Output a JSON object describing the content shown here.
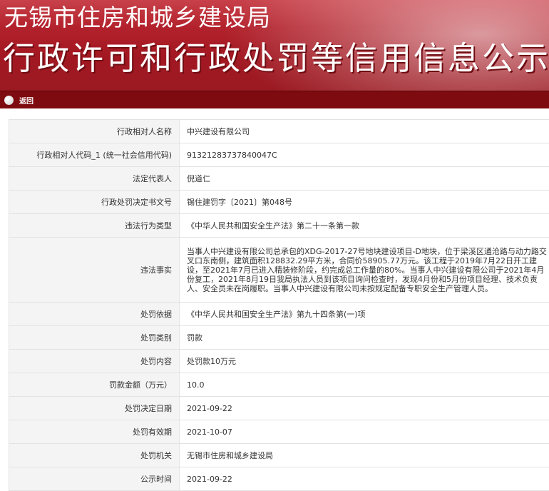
{
  "header": {
    "title": "无锡市住房和城乡建设局",
    "subtitle": "行政许可和行政处罚等信用信息公示专栏"
  },
  "nav": {
    "back_label": "返回"
  },
  "colors": {
    "banner": "#a31822",
    "navbar": "#7e0b10",
    "label_bg": "#f4f4f4",
    "border": "#e3e3e3"
  },
  "rows": [
    {
      "label": "行政相对人名称",
      "value": "中兴建设有限公司"
    },
    {
      "label": "行政相对人代码_1 (统一社会信用代码)",
      "value": "91321283737840047C"
    },
    {
      "label": "法定代表人",
      "value": "倪道仁"
    },
    {
      "label": "行政处罚决定书文号",
      "value": "锡住建罚字〔2021〕第048号"
    },
    {
      "label": "违法行为类型",
      "value": "《中华人民共和国安全生产法》第二十一条第一款"
    },
    {
      "label": "违法事实",
      "value": "当事人中兴建设有限公司总承包的XDG-2017-27号地块建设项目-D地块，位于梁溪区通沧路与动力路交叉口东南侧，建筑面积128832.29平方米，合同价58905.77万元。该工程于2019年7月22日开工建设，至2021年7月已进入精装修阶段，约完成总工作量的80%。当事人中兴建设有限公司于2021年4月份复工，2021年8月19日我局执法人员到该项目询问检查时，发现4月份和5月份项目经理、技术负责人、安全员未在岗履职。当事人中兴建设有限公司未按规定配备专职安全生产管理人员。"
    },
    {
      "label": "处罚依据",
      "value": "《中华人民共和国安全生产法》第九十四条第(一)项"
    },
    {
      "label": "处罚类别",
      "value": "罚款"
    },
    {
      "label": "处罚内容",
      "value": "处罚款10万元"
    },
    {
      "label": "罚款金额（万元）",
      "value": "10.0"
    },
    {
      "label": "处罚决定日期",
      "value": "2021-09-22"
    },
    {
      "label": "处罚有效期",
      "value": "2021-10-07"
    },
    {
      "label": "处罚机关",
      "value": "无锡市住房和城乡建设局"
    },
    {
      "label": "公示时间",
      "value": "2021-09-22"
    }
  ]
}
